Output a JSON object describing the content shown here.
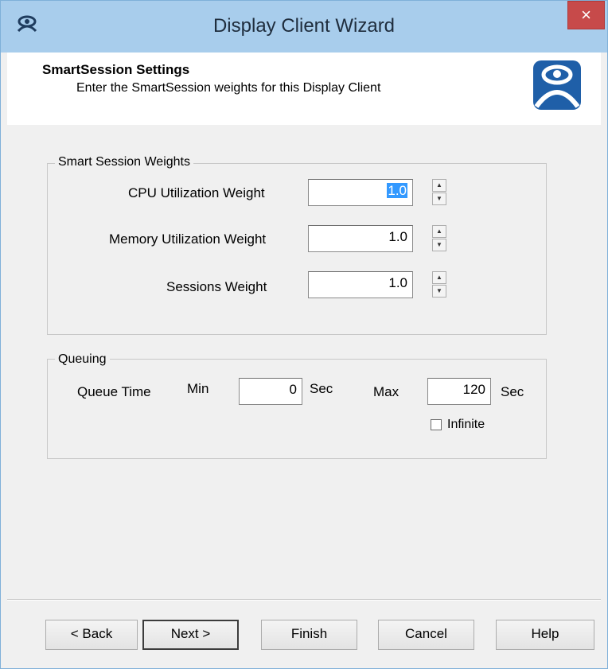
{
  "window": {
    "title": "Display Client Wizard",
    "close_glyph": "×",
    "accent": "#a8cdec",
    "close_color": "#c74a4a"
  },
  "header": {
    "title": "SmartSession Settings",
    "subtitle": "Enter the SmartSession weights for this Display Client"
  },
  "weights": {
    "legend": "Smart Session Weights",
    "cpu": {
      "label": "CPU Utilization Weight",
      "value": "1.0"
    },
    "memory": {
      "label": "Memory Utilization Weight",
      "value": "1.0"
    },
    "sessions": {
      "label": "Sessions Weight",
      "value": "1.0"
    }
  },
  "queuing": {
    "legend": "Queuing",
    "queue_time_label": "Queue Time",
    "min_label": "Min",
    "min_value": "0",
    "sec_label": "Sec",
    "max_label": "Max",
    "max_value": "120",
    "infinite_label": "Infinite",
    "infinite_checked": false
  },
  "buttons": {
    "back": "< Back",
    "next": "Next >",
    "finish": "Finish",
    "cancel": "Cancel",
    "help": "Help"
  },
  "icons": {
    "app": "thinmanager-icon",
    "logo": "thinmanager-logo-icon",
    "spin_up": "▲",
    "spin_down": "▼"
  }
}
